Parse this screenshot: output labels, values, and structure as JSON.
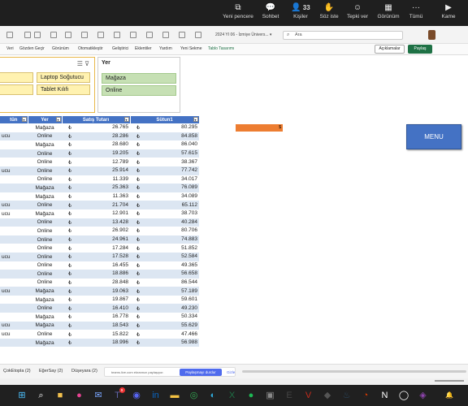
{
  "teams_toolbar": {
    "items": [
      {
        "label": "Yeni pencere",
        "icon": "new-window-icon",
        "glyph": "⧉"
      },
      {
        "label": "Sohbet",
        "icon": "chat-icon",
        "glyph": "💬"
      },
      {
        "label": "Kişiler",
        "icon": "people-icon",
        "glyph": "👤",
        "count": "33"
      },
      {
        "label": "Söz iste",
        "icon": "raise-hand-icon",
        "glyph": "✋"
      },
      {
        "label": "Tepki ver",
        "icon": "react-icon",
        "glyph": "☺"
      },
      {
        "label": "Görünüm",
        "icon": "view-icon",
        "glyph": "▦"
      },
      {
        "label": "Tümü",
        "icon": "more-icon",
        "glyph": "···"
      },
      {
        "label": "Kame",
        "icon": "camera-icon",
        "glyph": "▶"
      }
    ]
  },
  "excel": {
    "doc_title": "2024 YI 06 - İzmiye Ünivers... ▾",
    "search_placeholder": "Ara",
    "ribbon_menu": [
      "Veri",
      "Gözden Geçir",
      "Görünüm",
      "Otomatikleştir",
      "Geliştirici",
      "Eklentiler",
      "Yardım",
      "Yeni Sekme",
      "Tablo Tasarımı"
    ],
    "ribbon_active": "Tablo Tasarımı",
    "comments_button": "Açıklamalar",
    "share_button": "Paylaş",
    "slicer_product": {
      "items": [
        "",
        "Laptop Soğutucu",
        "",
        "Tablet Kılıfı"
      ]
    },
    "slicer_place": {
      "title": "Yer",
      "items": [
        "Mağaza",
        "Online"
      ]
    },
    "table": {
      "headers": [
        "tün",
        "Yer",
        "Satış Tutarı",
        "Sütun1"
      ],
      "currency_symbol": "₺",
      "rows": [
        {
          "urun": "",
          "yer": "Mağaza",
          "tutar": "26.765",
          "sutun1": "80.295"
        },
        {
          "urun": "ucu",
          "yer": "Online",
          "tutar": "28.286",
          "sutun1": "84.858"
        },
        {
          "urun": "",
          "yer": "Mağaza",
          "tutar": "28.680",
          "sutun1": "86.040"
        },
        {
          "urun": "",
          "yer": "Online",
          "tutar": "19.205",
          "sutun1": "57.615"
        },
        {
          "urun": "",
          "yer": "Online",
          "tutar": "12.789",
          "sutun1": "38.367"
        },
        {
          "urun": "ucu",
          "yer": "Online",
          "tutar": "25.914",
          "sutun1": "77.742"
        },
        {
          "urun": "",
          "yer": "Online",
          "tutar": "11.339",
          "sutun1": "34.017"
        },
        {
          "urun": "",
          "yer": "Mağaza",
          "tutar": "25.363",
          "sutun1": "76.089"
        },
        {
          "urun": "",
          "yer": "Mağaza",
          "tutar": "11.363",
          "sutun1": "34.089"
        },
        {
          "urun": "ucu",
          "yer": "Online",
          "tutar": "21.704",
          "sutun1": "65.112"
        },
        {
          "urun": "ucu",
          "yer": "Mağaza",
          "tutar": "12.901",
          "sutun1": "38.703"
        },
        {
          "urun": "",
          "yer": "Online",
          "tutar": "13.428",
          "sutun1": "40.284"
        },
        {
          "urun": "",
          "yer": "Online",
          "tutar": "26.902",
          "sutun1": "80.706"
        },
        {
          "urun": "",
          "yer": "Online",
          "tutar": "24.961",
          "sutun1": "74.883"
        },
        {
          "urun": "",
          "yer": "Online",
          "tutar": "17.284",
          "sutun1": "51.852"
        },
        {
          "urun": "ucu",
          "yer": "Online",
          "tutar": "17.528",
          "sutun1": "52.584"
        },
        {
          "urun": "",
          "yer": "Online",
          "tutar": "16.455",
          "sutun1": "49.365"
        },
        {
          "urun": "",
          "yer": "Online",
          "tutar": "18.886",
          "sutun1": "56.658"
        },
        {
          "urun": "",
          "yer": "Online",
          "tutar": "28.848",
          "sutun1": "86.544"
        },
        {
          "urun": "ucu",
          "yer": "Mağaza",
          "tutar": "19.063",
          "sutun1": "57.189"
        },
        {
          "urun": "",
          "yer": "Mağaza",
          "tutar": "19.867",
          "sutun1": "59.601"
        },
        {
          "urun": "",
          "yer": "Online",
          "tutar": "16.410",
          "sutun1": "49.230"
        },
        {
          "urun": "",
          "yer": "Mağaza",
          "tutar": "16.778",
          "sutun1": "50.334"
        },
        {
          "urun": "ucu",
          "yer": "Mağaza",
          "tutar": "18.543",
          "sutun1": "55.629"
        },
        {
          "urun": "ucu",
          "yer": "Online",
          "tutar": "15.822",
          "sutun1": "47.466"
        },
        {
          "urun": "",
          "yer": "Mağaza",
          "tutar": "18.996",
          "sutun1": "56.988"
        }
      ]
    },
    "orange_cell_text": "$",
    "menu_button": "MENU",
    "sheet_tabs": [
      "ÇokEtopla (2)",
      "EğerSay (2)",
      "Düşeyara (2)"
    ],
    "share_notice": {
      "text": "teams.live.com ekrannızı paylaşıyor.",
      "stop": "Paylaşmayı durdur",
      "hide": "Gizle"
    }
  },
  "taskbar": {
    "icons": [
      {
        "name": "windows-start-icon",
        "glyph": "⊞",
        "color": "#4cc2ff"
      },
      {
        "name": "search-icon",
        "glyph": "⌕",
        "color": "#ffffff"
      },
      {
        "name": "file-explorer-icon",
        "glyph": "■",
        "color": "#f2c14e"
      },
      {
        "name": "colorful-app-icon",
        "glyph": "●",
        "color": "#e84393"
      },
      {
        "name": "mail-icon",
        "glyph": "✉",
        "color": "#7aa6ff"
      },
      {
        "name": "teams-icon",
        "glyph": "T",
        "color": "#6264a7",
        "badge": "9"
      },
      {
        "name": "discord-icon",
        "glyph": "◉",
        "color": "#5865f2"
      },
      {
        "name": "linkedin-icon",
        "glyph": "in",
        "color": "#0a66c2"
      },
      {
        "name": "folder-icon",
        "glyph": "▬",
        "color": "#f5c242"
      },
      {
        "name": "chrome-icon",
        "glyph": "◎",
        "color": "#34a853"
      },
      {
        "name": "edge-icon",
        "glyph": "◐",
        "color": "#2fa9d8"
      },
      {
        "name": "excel-icon",
        "glyph": "X",
        "color": "#1e7145"
      },
      {
        "name": "spotify-icon",
        "glyph": "●",
        "color": "#1db954"
      },
      {
        "name": "app-icon",
        "glyph": "▣",
        "color": "#888888"
      },
      {
        "name": "epic-games-icon",
        "glyph": "E",
        "color": "#444444"
      },
      {
        "name": "app-red-icon",
        "glyph": "V",
        "color": "#c42b1c"
      },
      {
        "name": "app-dark-icon",
        "glyph": "◆",
        "color": "#555555"
      },
      {
        "name": "steam-icon",
        "glyph": "♨",
        "color": "#2a475e"
      },
      {
        "name": "office-icon",
        "glyph": "◔",
        "color": "#d83b01"
      },
      {
        "name": "notion-icon",
        "glyph": "N",
        "color": "#ffffff"
      },
      {
        "name": "github-icon",
        "glyph": "◯",
        "color": "#ffffff"
      },
      {
        "name": "app-purple-icon",
        "glyph": "◈",
        "color": "#8e44ad"
      }
    ]
  }
}
